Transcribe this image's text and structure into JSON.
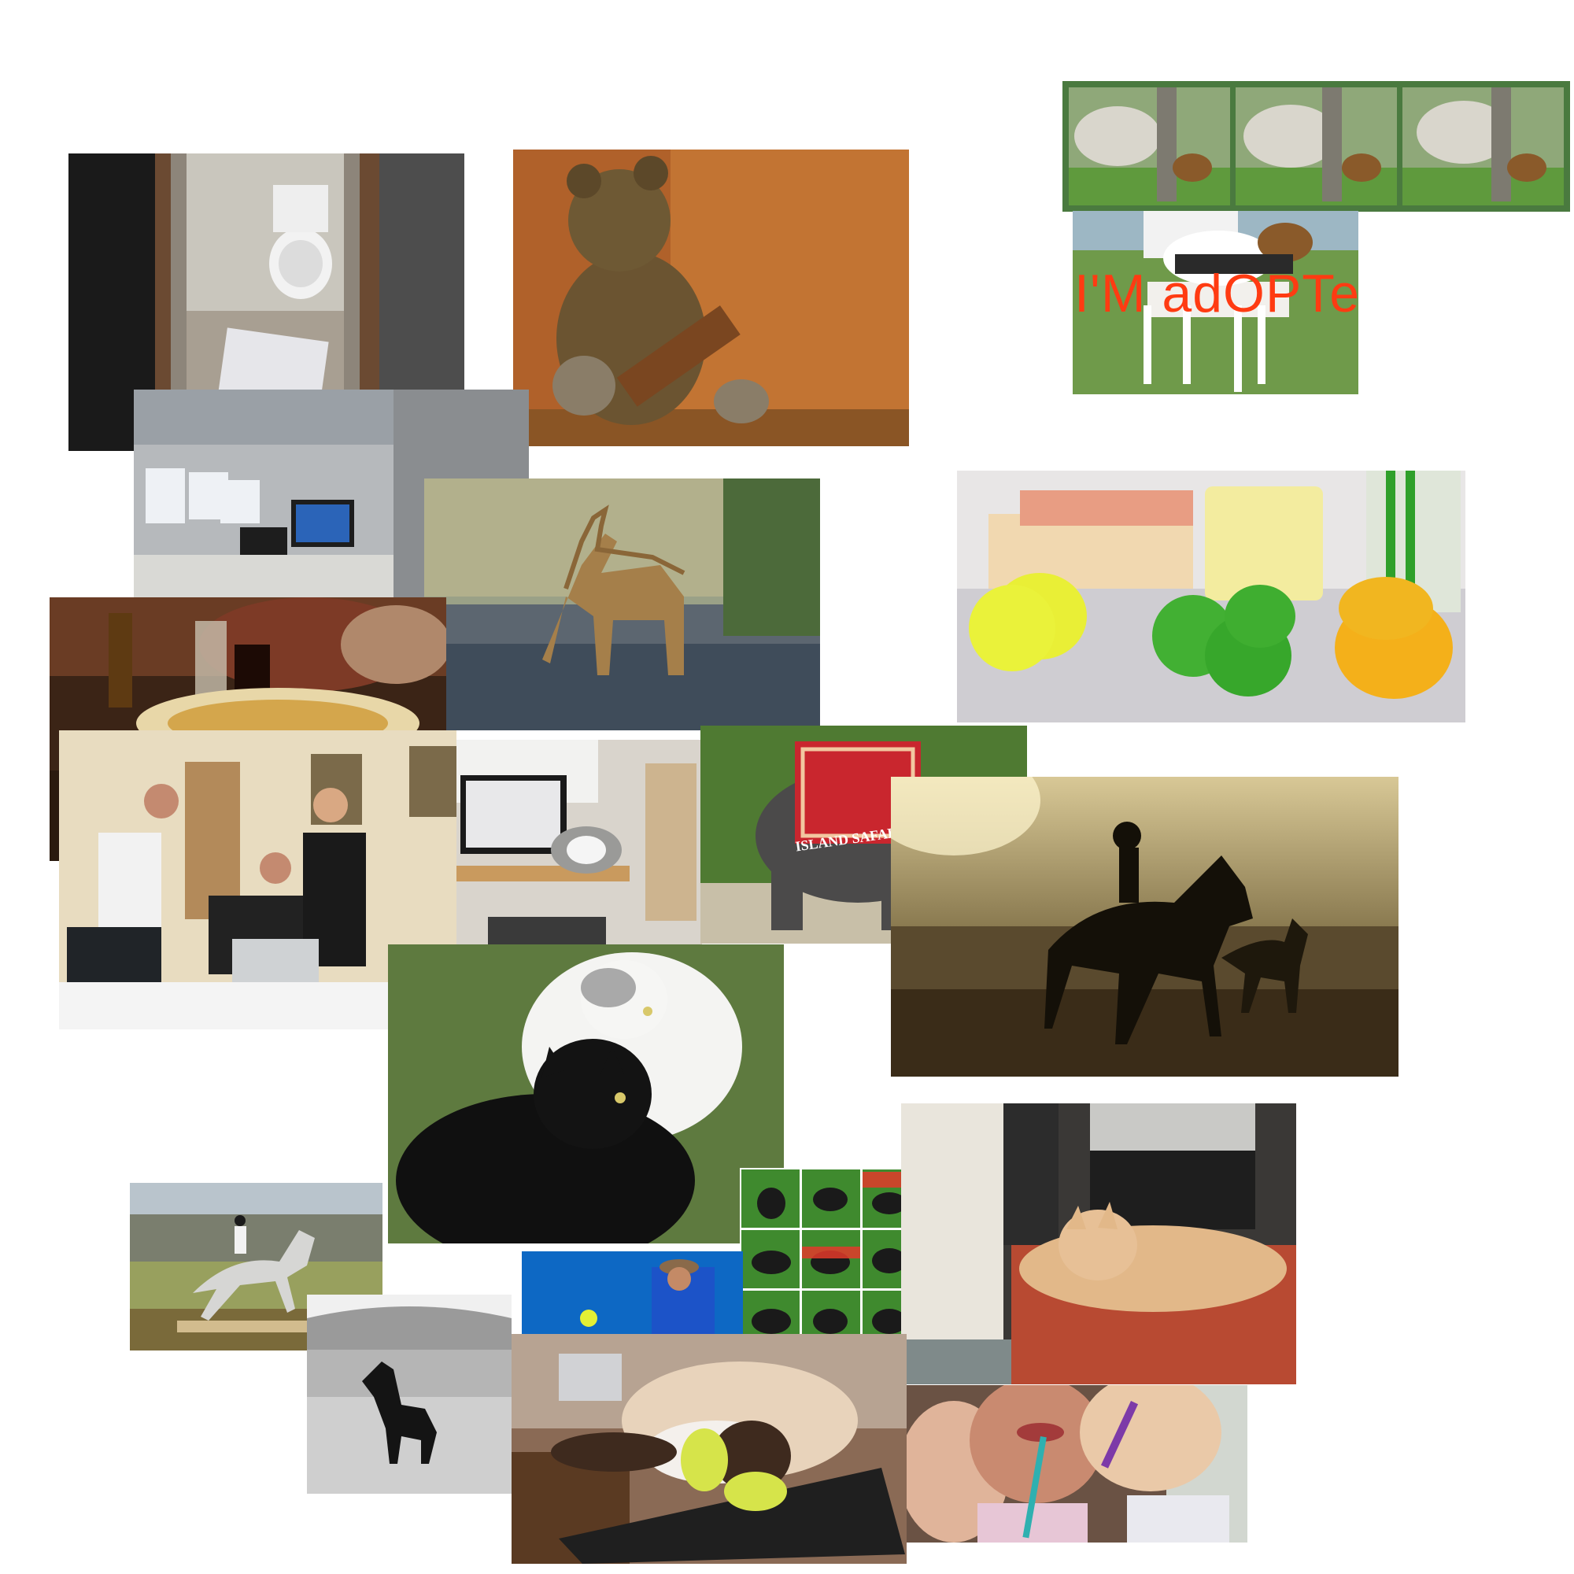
{
  "collage": {
    "photos": [
      {
        "subject": "bathroom-toilet"
      },
      {
        "subject": "teddy-bear"
      },
      {
        "subject": "sheep-and-dog-triptych"
      },
      {
        "subject": "adopted-dog",
        "caption": "I'M adOPTed"
      },
      {
        "subject": "office-cubicle"
      },
      {
        "subject": "giraffes-drinking"
      },
      {
        "subject": "citrus-fruits"
      },
      {
        "subject": "restaurant-table"
      },
      {
        "subject": "office-meeting"
      },
      {
        "subject": "cat-computer-desk"
      },
      {
        "subject": "elephant-banner",
        "banner_text": "ISLAND SAFARI"
      },
      {
        "subject": "horse-silhouette-beach"
      },
      {
        "subject": "black-and-white-cats"
      },
      {
        "subject": "dog-grid"
      },
      {
        "subject": "cat-on-couch"
      },
      {
        "subject": "show-jumping-horse"
      },
      {
        "subject": "tennis-player"
      },
      {
        "subject": "black-white-horse"
      },
      {
        "subject": "siamese-cat-playing"
      },
      {
        "subject": "girls-brushing-teeth"
      }
    ]
  }
}
